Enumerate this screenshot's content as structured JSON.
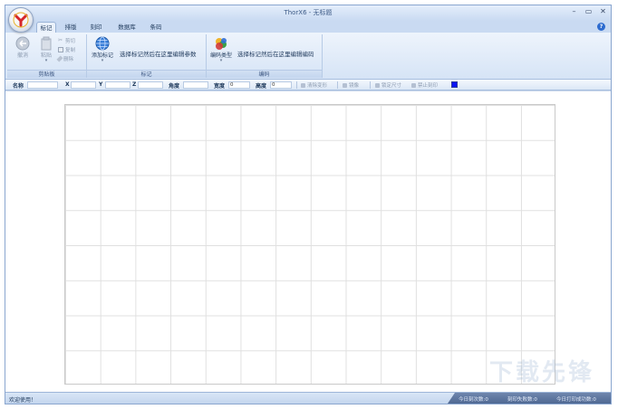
{
  "window": {
    "title": "ThorX6 - 无标题",
    "controls": {
      "minimize": "–",
      "maximize": "▭",
      "close": "✕"
    }
  },
  "tabs": [
    {
      "label": "标记",
      "active": true
    },
    {
      "label": "排版",
      "active": false
    },
    {
      "label": "刻印",
      "active": false
    },
    {
      "label": "数据库",
      "active": false
    },
    {
      "label": "条码",
      "active": false
    }
  ],
  "help": {
    "glyph": "?"
  },
  "ribbon": {
    "clipboard": {
      "label": "剪贴板",
      "undo": "撤消",
      "paste": "粘贴",
      "cut": "剪切",
      "copy": "复制",
      "delete": "删除"
    },
    "marking": {
      "label": "标记",
      "add_button": "添加标记",
      "hint": "选择标记然后在这里编辑参数"
    },
    "encoding": {
      "label": "编码",
      "type_button": "编码类型",
      "hint": "选择标记然后在这里编辑编码"
    }
  },
  "propbar": {
    "name_label": "名称",
    "x_label": "X",
    "y_label": "Y",
    "z_label": "Z",
    "angle_label": "角度",
    "width_label": "宽度",
    "width_value": "0",
    "height_label": "高度",
    "height_value": "0",
    "clear_transform": "清除变形",
    "mirror": "镜像",
    "lock_size": "锁定尺寸",
    "disable_print": "禁止刻印",
    "color": "#0a14f5"
  },
  "status": {
    "message": "欢迎使用！",
    "pane1": "今日刻次数:0",
    "pane2": "刻印失败数:0",
    "pane3": "今日打印成功数:0"
  },
  "watermark": "下载先锋"
}
